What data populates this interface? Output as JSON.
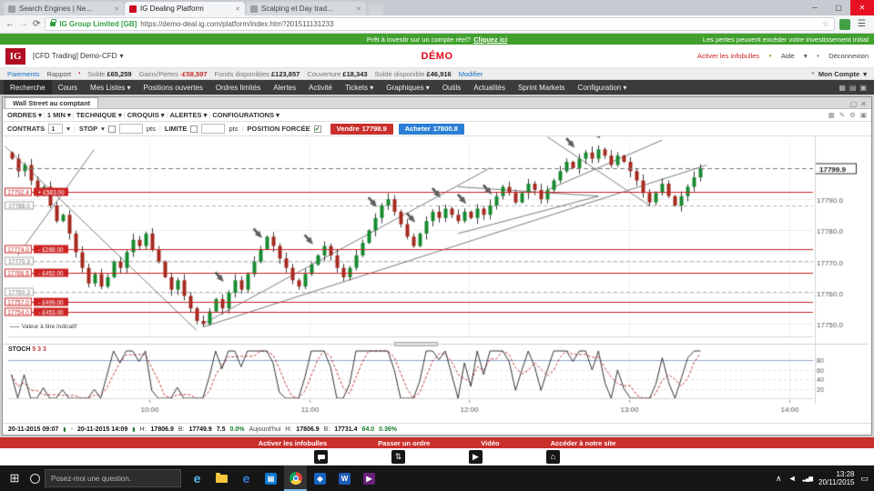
{
  "icons": {
    "close": "✕",
    "minimize": "─",
    "maximize": "▢",
    "back": "←",
    "forward": "→",
    "refresh": "⟳",
    "star": "☆",
    "menu": "☰",
    "grid": "▦",
    "rows": "▤",
    "pin": "▣",
    "pencil": "✎",
    "gear": "⚙",
    "dropdown": "▾",
    "dot": "●",
    "bullet": "▪",
    "check": "✔",
    "start": "⊞",
    "caret": "∧",
    "speaker": "◄",
    "signal": "▂▄▆",
    "box": "▭",
    "updown": "⇅",
    "play": "▶",
    "home": "⌂",
    "candle": "▮",
    "e": "e",
    "w": "W",
    "diamond": "◆",
    "sep": "|"
  },
  "browser": {
    "tabs": [
      {
        "title": "Search Engines | Ne..."
      },
      {
        "title": "IG Dealing Platform"
      },
      {
        "title": "Scalping et Day trad..."
      }
    ],
    "badge": "IG Group Limited [GB]",
    "url": "https://demo-deal.ig.com/platform/index.htm?201511131233"
  },
  "promo": {
    "text": "Prêt à investir sur un compte réel?",
    "link": "Cliquez ici",
    "right": "Les pertes peuvent excéder votre investissement initial"
  },
  "header": {
    "logo": "IG",
    "account": "[CFD Trading] Demo-CFD",
    "demo": "DÉMO",
    "tooltips": "Activer les infobulles",
    "help": "Aide",
    "logout": "Déconnexion",
    "nav": {
      "paiements": "Paiements",
      "rapport": "Rapport",
      "modifier": "Modifier",
      "mon_compte": "Mon Compte"
    },
    "balances": [
      {
        "label": "Solde",
        "value": "£65,259"
      },
      {
        "label": "Gains/Pertes",
        "value": "-£58,597"
      },
      {
        "label": "Fonds disponibles",
        "value": "£123,857"
      },
      {
        "label": "Couverture",
        "value": "£18,343"
      },
      {
        "label": "Solde disponible",
        "value": "£46,916"
      }
    ]
  },
  "menu": {
    "items": [
      "Recherche",
      "Cours",
      "Mes Listes ▾",
      "Positions ouvertes",
      "Ordres limités",
      "Alertes",
      "Activité",
      "Tickets ▾",
      "Graphiques ▾",
      "Outils",
      "Actualités",
      "Sprint Markets",
      "Configuration ▾"
    ]
  },
  "window": {
    "tab": "Wall Street au comptant",
    "toolbar": [
      "ORDRES ▾",
      "1 MIN ▾",
      "TECHNIQUE ▾",
      "CROQUIS ▾",
      "ALERTES ▾",
      "CONFIGURATIONS ▾"
    ],
    "order_bar": {
      "contrats": "CONTRATS",
      "contrats_value": "1",
      "stop": "STOP",
      "stop_value": "",
      "stop_unit": "pts",
      "limite": "LIMITE",
      "limite_value": "",
      "limite_unit": "pts",
      "position": "POSITION FORCÉE",
      "sell": "Vendre",
      "sell_price": "17798.9",
      "buy": "Acheter",
      "buy_price": "17800.8"
    },
    "indicative": "Valeur à titre indicatif",
    "stoch_title": "STOCH",
    "stoch_params": "5 3 3"
  },
  "chart_data": {
    "type": "candlestick",
    "title": "Wall Street au comptant",
    "interval": "1 MIN",
    "y_axis": {
      "min": 17746,
      "max": 17809,
      "ticks": [
        17790,
        17780,
        17770,
        17760,
        17750
      ],
      "tick_labels": [
        "17790.0",
        "17780.0",
        "17770.0",
        "17760.0",
        "17750.0"
      ],
      "current_value": 17799.9,
      "current_price": "17799.9"
    },
    "x_axis": {
      "labels": [
        "10:00",
        "11:00",
        "12:00",
        "13:00",
        "14:00"
      ],
      "tick_minutes": [
        53,
        113,
        173,
        233,
        293
      ],
      "total_minutes": 302,
      "data_minutes": 261
    },
    "open_first": 17805,
    "closes": [
      17803,
      17799,
      17801,
      17796,
      17792,
      17794,
      17788,
      17783,
      17785,
      17779,
      17773,
      17768,
      17763,
      17766,
      17762,
      17765,
      17770,
      17768,
      17773,
      17777,
      17775,
      17779,
      17774,
      17770,
      17765,
      17761,
      17764,
      17759,
      17755,
      17751,
      17750,
      17754,
      17758,
      17755,
      17760,
      17764,
      17761,
      17766,
      17770,
      17774,
      17778,
      17775,
      17771,
      17768,
      17764,
      17762,
      17766,
      17769,
      17772,
      17775,
      17772,
      17768,
      17765,
      17768,
      17772,
      17776,
      17780,
      17784,
      17788,
      17790,
      17786,
      17782,
      17778,
      17775,
      17779,
      17783,
      17786,
      17784,
      17787,
      17785,
      17783,
      17786,
      17784,
      17787,
      17785,
      17788,
      17791,
      17794,
      17792,
      17789,
      17792,
      17795,
      17793,
      17790,
      17793,
      17796,
      17799,
      17802,
      17800,
      17803,
      17805,
      17803,
      17806,
      17804,
      17801,
      17804,
      17802,
      17799,
      17796,
      17792,
      17789,
      17792,
      17795,
      17791,
      17788,
      17791,
      17794,
      17797,
      17800
    ],
    "levels": [
      {
        "price": 17792.4,
        "price_label": "17792.4",
        "amount": "+ £583.00"
      },
      {
        "price": 17774.0,
        "price_label": "17774.0",
        "amount": "- £288.00"
      },
      {
        "price": 17766.5,
        "price_label": "17766.5",
        "amount": "- £452.00"
      },
      {
        "price": 17757.0,
        "price_label": "17757.0",
        "amount": "- £499.00"
      },
      {
        "price": 17754.0,
        "price_label": "17754.0",
        "amount": "- £453.00"
      }
    ],
    "dashed_levels": [
      {
        "price": 17788.0,
        "label": "17788.0"
      },
      {
        "price": 17770.3,
        "label": "17770.3"
      },
      {
        "price": 17760.3,
        "label": "17760.3"
      }
    ],
    "trendlines": [
      [
        -1,
        17807,
        29,
        17748
      ],
      [
        1,
        17772,
        13,
        17806
      ],
      [
        30,
        17749,
        109,
        17801
      ],
      [
        30,
        17750,
        75,
        17800
      ],
      [
        70,
        17779,
        92,
        17791
      ],
      [
        70,
        17794,
        92,
        17791
      ],
      [
        84,
        17810,
        100,
        17788
      ],
      [
        84,
        17793,
        102,
        17809
      ]
    ],
    "annotations": [
      [
        33,
        17763
      ],
      [
        39,
        17777
      ],
      [
        47,
        17775
      ],
      [
        57,
        17787
      ],
      [
        63,
        17782
      ],
      [
        67,
        17790
      ],
      [
        71,
        17788
      ],
      [
        75,
        17791
      ],
      [
        88,
        17806
      ],
      [
        92,
        17809
      ]
    ],
    "stoch": {
      "name": "STOCH",
      "params": "5 3 3",
      "ticks": [
        80,
        60,
        40,
        20
      ]
    },
    "colors": {
      "up": "#168a2f",
      "down": "#a5281f",
      "level": "#cc2222",
      "trend": "#5a5a5a",
      "stoch_k": "#333333",
      "stoch_d": "#c23b3b",
      "current": "#777777"
    }
  },
  "status": {
    "from": "20-11-2015 09:07",
    "sep": "-",
    "to": "20-11-2015 14:09",
    "h_label": "H:",
    "high": "17806.9",
    "b_label": "B:",
    "low": "17749.9",
    "range": "7.5",
    "range_pct": "0.0%",
    "today_label": "Aujourd'hui",
    "today_high": "17806.9",
    "today_low": "17731.4",
    "today_range": "64.0",
    "today_pct": "0.36%"
  },
  "footer": {
    "items": [
      "Activer les infobulles",
      "Passer un ordre",
      "Vidéo",
      "Accéder à notre site"
    ]
  },
  "taskbar": {
    "search": "Posez-moi une question.",
    "time": "13:28",
    "date": "20/11/2015"
  }
}
